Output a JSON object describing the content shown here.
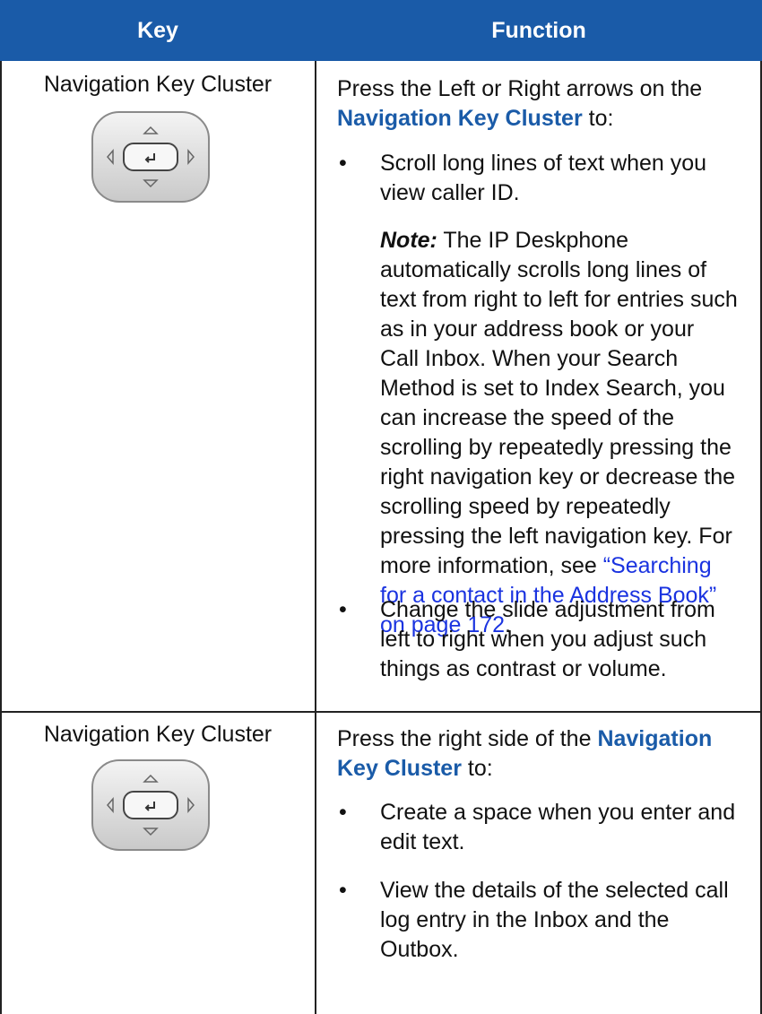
{
  "table": {
    "headers": {
      "key": "Key",
      "function": "Function"
    },
    "rows": [
      {
        "key_label": "Navigation Key Cluster",
        "key_icon": "navigation-key-cluster-icon",
        "intro_prefix": "Press the Left or Right arrows on the ",
        "intro_link": "Navigation Key Cluster",
        "intro_suffix": " to:",
        "bullet1": "Scroll long lines of text when you view caller ID.",
        "note_label": "Note:",
        "note_text": " The IP Deskphone automatically scrolls long lines of text from right to left for entries such as in your address book or your Call Inbox. When your Search Method is set to Index Search, you can increase the speed of the scrolling by repeatedly pressing the right navigation key or decrease the scrolling speed by repeatedly pressing the left navigation key. For more information, see ",
        "note_link": "“Searching for a contact in the Address Book” on page 172",
        "note_end": ".",
        "bullet2": "Change the slide adjustment from left to right when you adjust such things as contrast or volume."
      },
      {
        "key_label": "Navigation Key Cluster",
        "key_icon": "navigation-key-cluster-icon",
        "intro_prefix": "Press the right side of the ",
        "intro_link": "Navigation Key Cluster",
        "intro_suffix": " to:",
        "bullet1": "Create a space when you enter and edit text.",
        "bullet2": "View the details of the selected call log entry in the Inbox and the Outbox."
      }
    ]
  },
  "colors": {
    "header_bg": "#1a5ba8",
    "link_blue": "#1a5ba8",
    "xref_blue": "#1a33e0"
  }
}
